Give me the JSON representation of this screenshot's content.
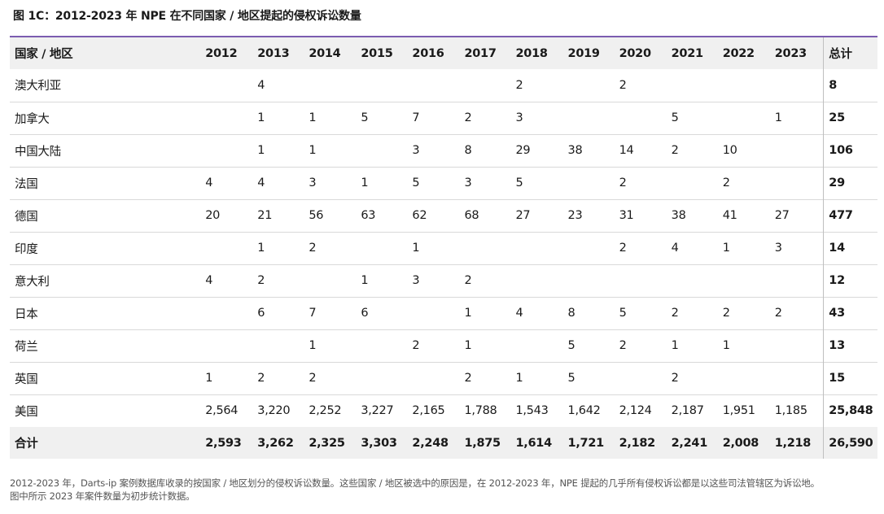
{
  "title": "图 1C：2012-2023 年 NPE 在不同国家 / 地区提起的侵权诉讼数量",
  "table": {
    "header": [
      "国家 / 地区",
      "2012",
      "2013",
      "2014",
      "2015",
      "2016",
      "2017",
      "2018",
      "2019",
      "2020",
      "2021",
      "2022",
      "2023",
      "总计"
    ],
    "rows": [
      [
        "澳大利亚",
        "",
        "4",
        "",
        "",
        "",
        "",
        "2",
        "",
        "2",
        "",
        "",
        "",
        "8"
      ],
      [
        "加拿大",
        "",
        "1",
        "1",
        "5",
        "7",
        "2",
        "3",
        "",
        "",
        "5",
        "",
        "1",
        "25"
      ],
      [
        "中国大陆",
        "",
        "1",
        "1",
        "",
        "3",
        "8",
        "29",
        "38",
        "14",
        "2",
        "10",
        "",
        "106"
      ],
      [
        "法国",
        "4",
        "4",
        "3",
        "1",
        "5",
        "3",
        "5",
        "",
        "2",
        "",
        "2",
        "",
        "29"
      ],
      [
        "德国",
        "20",
        "21",
        "56",
        "63",
        "62",
        "68",
        "27",
        "23",
        "31",
        "38",
        "41",
        "27",
        "477"
      ],
      [
        "印度",
        "",
        "1",
        "2",
        "",
        "1",
        "",
        "",
        "",
        "2",
        "4",
        "1",
        "3",
        "14"
      ],
      [
        "意大利",
        "4",
        "2",
        "",
        "1",
        "3",
        "2",
        "",
        "",
        "",
        "",
        "",
        "",
        "12"
      ],
      [
        "日本",
        "",
        "6",
        "7",
        "6",
        "",
        "1",
        "4",
        "8",
        "5",
        "2",
        "2",
        "2",
        "43"
      ],
      [
        "荷兰",
        "",
        "",
        "1",
        "",
        "2",
        "1",
        "",
        "5",
        "2",
        "1",
        "1",
        "",
        "13"
      ],
      [
        "英国",
        "1",
        "2",
        "2",
        "",
        "",
        "2",
        "1",
        "5",
        "",
        "2",
        "",
        "",
        "15"
      ],
      [
        "美国",
        "2,564",
        "3,220",
        "2,252",
        "3,227",
        "2,165",
        "1,788",
        "1,543",
        "1,642",
        "2,124",
        "2,187",
        "1,951",
        "1,185",
        "25,848"
      ]
    ],
    "footer": [
      "合计",
      "2,593",
      "3,262",
      "2,325",
      "3,303",
      "2,248",
      "1,875",
      "1,614",
      "1,721",
      "2,182",
      "2,241",
      "2,008",
      "1,218",
      "26,590"
    ]
  },
  "note": {
    "line1": "2012-2023 年，Darts-ip 案例数据库收录的按国家 / 地区划分的侵权诉讼数量。这些国家 / 地区被选中的原因是，在 2012-2023 年，NPE 提起的几乎所有侵权诉讼都是以这些司法管辖区为诉讼地。",
    "line2": "图中所示 2023 年案件数量为初步统计数据。"
  },
  "colors": {
    "accent": "#7b5cb0",
    "header_bg": "#f0f0f0",
    "row_divider": "#d9d9d9"
  }
}
